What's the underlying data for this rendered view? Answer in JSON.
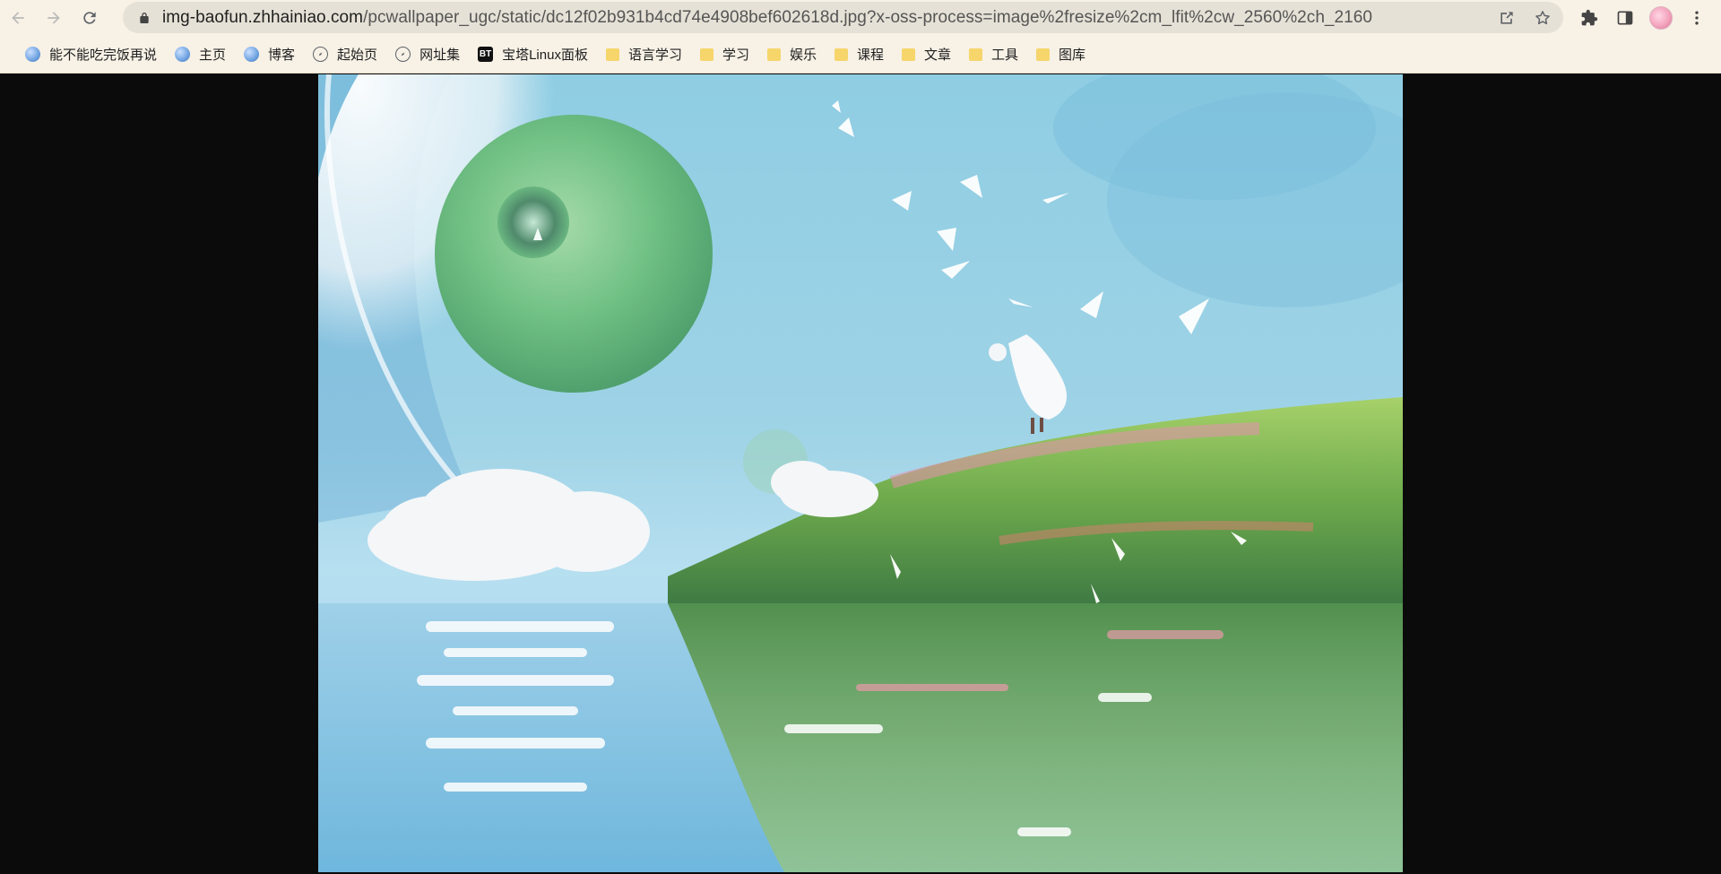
{
  "toolbar": {
    "back_icon": "arrow-left-icon",
    "forward_icon": "arrow-right-icon",
    "reload_icon": "reload-icon"
  },
  "address_bar": {
    "host": "img-baofun.zhhainiao.com",
    "path": "/pcwallpaper_ugc/static/dc12f02b931b4cd74e4908bef602618d.jpg?x-oss-process=image%2fresize%2cm_lfit%2cw_2560%2ch_2160",
    "lock_icon": "lock-icon",
    "share_icon": "share-icon",
    "star_icon": "star-icon"
  },
  "right_tools": {
    "extensions_icon": "puzzle-icon",
    "side_panel_icon": "side-panel-icon",
    "profile_icon": "avatar",
    "menu_icon": "more-vert-icon"
  },
  "bookmarks": [
    {
      "label": "能不能吃完饭再说",
      "icon": "globe-icon"
    },
    {
      "label": "主页",
      "icon": "globe-icon"
    },
    {
      "label": "博客",
      "icon": "globe-icon"
    },
    {
      "label": "起始页",
      "icon": "compass-icon"
    },
    {
      "label": "网址集",
      "icon": "compass-icon"
    },
    {
      "label": "宝塔Linux面板",
      "icon": "bt-icon",
      "icon_text": "BT"
    },
    {
      "label": "语言学习",
      "icon": "folder-icon"
    },
    {
      "label": "学习",
      "icon": "folder-icon"
    },
    {
      "label": "娱乐",
      "icon": "folder-icon"
    },
    {
      "label": "课程",
      "icon": "folder-icon"
    },
    {
      "label": "文章",
      "icon": "folder-icon"
    },
    {
      "label": "工具",
      "icon": "folder-icon"
    },
    {
      "label": "图库",
      "icon": "folder-icon"
    }
  ],
  "colors": {
    "toolbar_bg": "#f7f1e6",
    "omnibox_bg": "#e6e1d6",
    "viewer_bg": "#0b0b0b",
    "folder": "#f6d56b"
  }
}
